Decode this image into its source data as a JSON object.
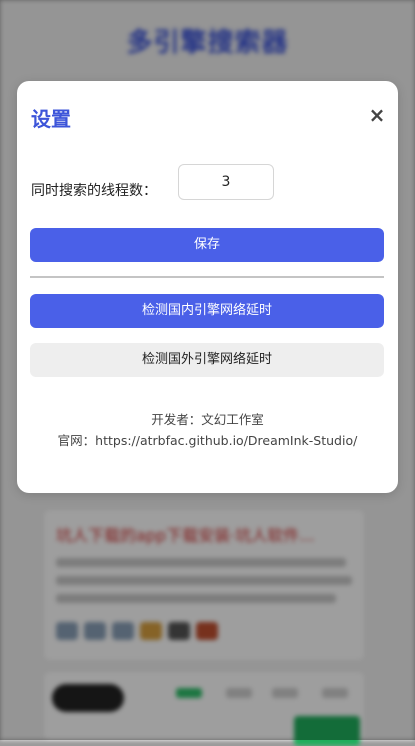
{
  "background": {
    "app_title": "多引擎搜索器",
    "card_title": "坑人下载的app下载安装·坑人软件..."
  },
  "modal": {
    "title": "设置",
    "close_label": "×",
    "thread_label": "同时搜索的线程数：",
    "thread_value": "3",
    "save_button": "保存",
    "domestic_latency_button": "检测国内引擎网络延时",
    "foreign_latency_button": "检测国外引擎网络延时",
    "developer": "开发者：文幻工作室",
    "website": "官网：https://atrbfac.github.io/DreamInk-Studio/"
  },
  "colors": {
    "accent": "#4a60e8",
    "title": "#3d55d9",
    "secondary_button": "#eeeeee"
  }
}
